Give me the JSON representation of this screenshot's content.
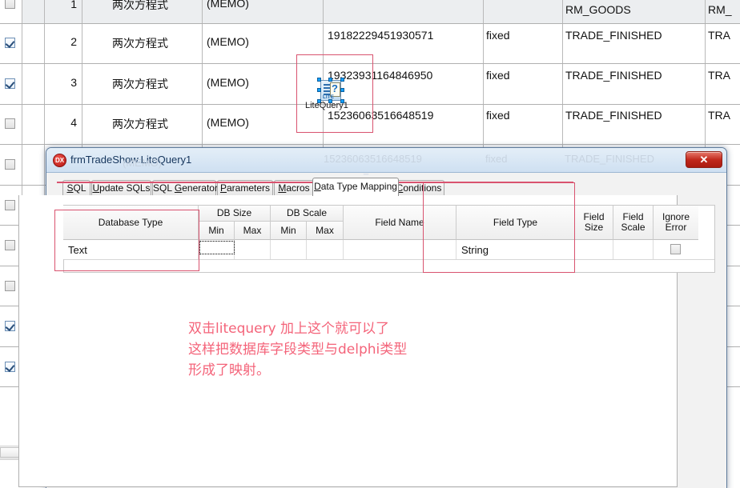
{
  "background": {
    "grid": {
      "row_header_label": "",
      "columns": [
        {
          "name": "checkbox",
          "header": ""
        },
        {
          "name": "rownum",
          "header": ""
        },
        {
          "name": "name",
          "header": ""
        },
        {
          "name": "memo",
          "header": ""
        },
        {
          "name": "id",
          "header": ""
        },
        {
          "name": "kind",
          "header": ""
        },
        {
          "name": "status_goods",
          "header": "RM_GOODS"
        },
        {
          "name": "status_trade",
          "header": "RM_"
        }
      ],
      "rows": [
        {
          "checked": false,
          "num": "1",
          "name": "两次方程式",
          "memo": "(MEMO)",
          "id": "",
          "kind": "",
          "goods": "",
          "trade": ""
        },
        {
          "checked": true,
          "num": "2",
          "name": "两次方程式",
          "memo": "(MEMO)",
          "id": "19182229451930571",
          "kind": "fixed",
          "goods": "TRADE_FINISHED",
          "trade": "TRA"
        },
        {
          "checked": true,
          "num": "3",
          "name": "两次方程式",
          "memo": "(MEMO)",
          "id": "19323931164846950",
          "kind": "fixed",
          "goods": "TRADE_FINISHED",
          "trade": "TRA"
        },
        {
          "checked": false,
          "num": "4",
          "name": "两次方程式",
          "memo": "(MEMO)",
          "id": "15236063516648519",
          "kind": "fixed",
          "goods": "TRADE_FINISHED",
          "trade": "TRA"
        }
      ],
      "hidden_row_checkboxes": [
        false,
        false,
        false,
        false,
        true,
        true
      ]
    },
    "component": {
      "label": "LiteQuery1",
      "icon": "litequery-component-icon",
      "glyph": "?",
      "tag": "LITE"
    }
  },
  "dialog": {
    "title": "frmTradeShow.LiteQuery1",
    "badge": "DX",
    "close_label": "✕",
    "tabs": [
      {
        "id": "sql",
        "label": "SQL",
        "accel": "S",
        "active": false
      },
      {
        "id": "update",
        "label": "Update SQLs",
        "accel": "U",
        "active": false
      },
      {
        "id": "generator",
        "label": "SQL Generator",
        "accel": "G",
        "active": false
      },
      {
        "id": "parameters",
        "label": "Parameters",
        "accel": "P",
        "active": false
      },
      {
        "id": "macros",
        "label": "Macros",
        "accel": "M",
        "active": false
      },
      {
        "id": "mapping",
        "label": "Data Type Mapping",
        "accel": "D",
        "active": true
      },
      {
        "id": "conditions",
        "label": "Conditions",
        "accel": "C",
        "active": false
      }
    ],
    "mapping_grid": {
      "group_headers": [
        {
          "label": "DB Size"
        },
        {
          "label": "DB Scale"
        }
      ],
      "headers": [
        {
          "label": "Database Type"
        },
        {
          "label": "Min"
        },
        {
          "label": "Max"
        },
        {
          "label": "Min"
        },
        {
          "label": "Max"
        },
        {
          "label": "Field Name"
        },
        {
          "label": "Field Type"
        },
        {
          "label": "Field\nSize"
        },
        {
          "label": "Field\nScale"
        },
        {
          "label": "Ignore\nError"
        }
      ],
      "rows": [
        {
          "database_type": "Text",
          "db_size_min": "",
          "db_size_max": "",
          "db_scale_min": "",
          "db_scale_max": "",
          "field_name": "",
          "field_type": "String",
          "field_size": "",
          "field_scale": "",
          "ignore_error": false
        }
      ]
    }
  },
  "annotation": {
    "color": "#f4647a",
    "lines": [
      "双击litequery 加上这个就可以了",
      "这样把数据库字段类型与delphi类型",
      "形成了映射。"
    ],
    "text": "双击litequery 加上这个就可以了\n这样把数据库字段类型与delphi类型\n形成了映射。"
  }
}
